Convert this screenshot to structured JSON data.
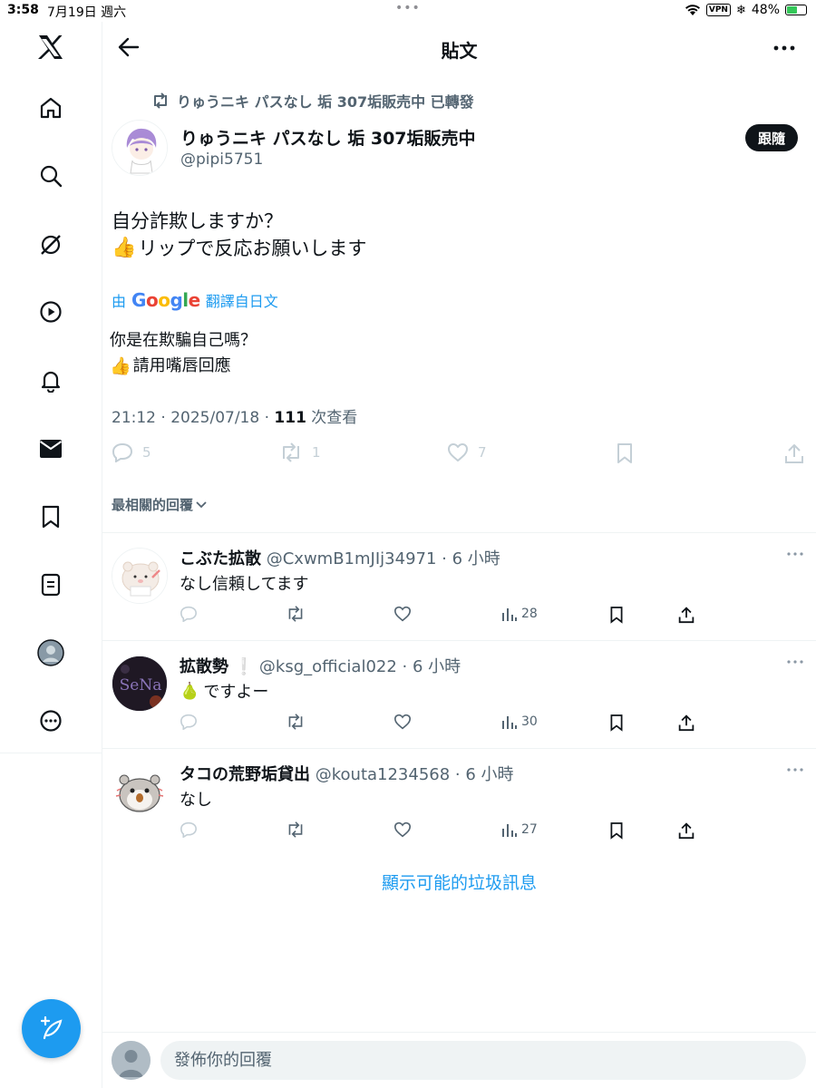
{
  "status_bar": {
    "time": "3:58",
    "date": "7月19日 週六",
    "vpn": "VPN",
    "battery": "48%",
    "battery_level": 0.48
  },
  "sidebar": {
    "items": [
      {
        "icon": "x-logo-icon"
      },
      {
        "icon": "home-icon"
      },
      {
        "icon": "search-icon"
      },
      {
        "icon": "grok-icon"
      },
      {
        "icon": "video-icon"
      },
      {
        "icon": "notifications-icon"
      },
      {
        "icon": "messages-icon"
      },
      {
        "icon": "bookmarks-icon"
      },
      {
        "icon": "lists-icon"
      },
      {
        "icon": "profile-icon"
      },
      {
        "icon": "more-icon"
      }
    ],
    "compose_icon": "compose-post-icon"
  },
  "header": {
    "title": "貼文"
  },
  "post": {
    "repost_label": "りゅうニキ パスなし 垢 307垢販売中 已轉發",
    "author_name": "りゅうニキ パスなし 垢 307垢販売中",
    "author_handle": "@pipi5751",
    "follow_label": "跟隨",
    "text_line1": "自分詐欺しますか？",
    "text_line2": "リップで反応お願いします",
    "translate_prefix": "由",
    "translate_brand": "Google",
    "translate_suffix": "翻譯自日文",
    "translated_line1": "你是在欺騙自己嗎？",
    "translated_line2": "請用嘴唇回應",
    "timestamp": "21:12 · 2025/07/18 · ",
    "views_count": "111",
    "views_label": " 次查看",
    "reply_count": "5",
    "repost_count": "1",
    "like_count": "7"
  },
  "replies_sort": "最相關的回覆",
  "replies": [
    {
      "name": "こぶた拡散",
      "handle": "@CxwmB1mJIj34971 · 6 小時",
      "text": "なし信頼してます",
      "views": "28"
    },
    {
      "name": "拡散勢",
      "handle": "@ksg_official022 · 6 小時",
      "text": "ですよー",
      "views": "30",
      "avatar_text": "SeNa"
    },
    {
      "name": "タコの荒野垢貸出",
      "handle": "@kouta1234568 · 6 小時",
      "text": "なし",
      "views": "27"
    }
  ],
  "spam_link": "顯示可能的垃圾訊息",
  "compose": {
    "placeholder": "發佈你的回覆"
  },
  "colors": {
    "accent": "#1d9bf0",
    "text": "#0f1419",
    "secondary": "#536471"
  }
}
